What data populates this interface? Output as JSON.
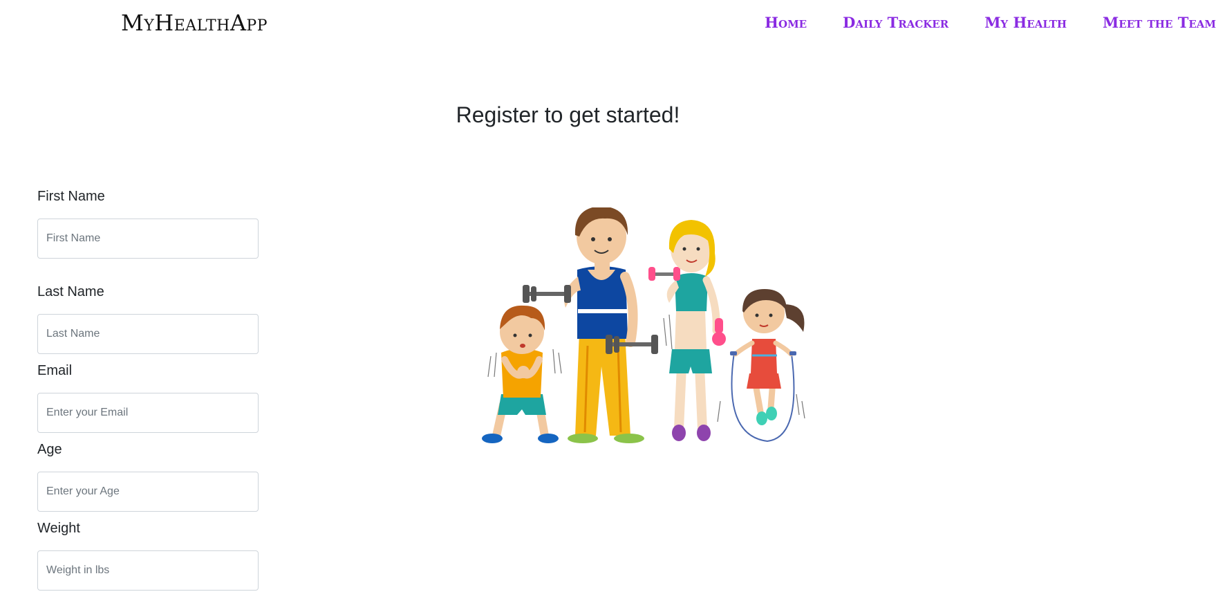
{
  "brand": "MyHealthApp",
  "nav": {
    "items": [
      {
        "label": "Home"
      },
      {
        "label": "Daily Tracker"
      },
      {
        "label": "My Health"
      },
      {
        "label": "Meet the Team"
      }
    ]
  },
  "page": {
    "heading": "Register to get started!"
  },
  "form": {
    "fields": [
      {
        "label": "First Name",
        "placeholder": "First Name",
        "value": ""
      },
      {
        "label": "Last Name",
        "placeholder": "Last Name",
        "value": ""
      },
      {
        "label": "Email",
        "placeholder": "Enter your Email",
        "value": ""
      },
      {
        "label": "Age",
        "placeholder": "Enter your Age",
        "value": ""
      },
      {
        "label": "Weight",
        "placeholder": "Weight in lbs",
        "value": ""
      }
    ]
  },
  "illustration": {
    "subject": "family-exercising-illustration"
  },
  "colors": {
    "nav_link": "#8a2be2",
    "text": "#212529",
    "input_border": "#ced4da"
  }
}
